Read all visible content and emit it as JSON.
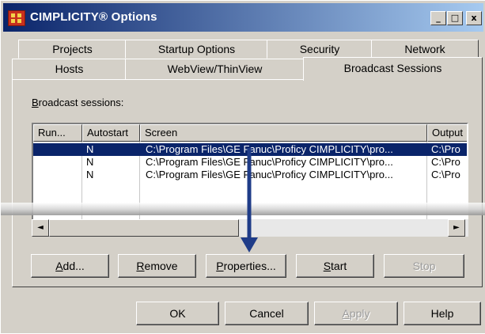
{
  "window": {
    "title": "CIMPLICITY® Options"
  },
  "titlebar_buttons": {
    "minimize": "_",
    "maximize": "□",
    "close": "x"
  },
  "tabs_row1": [
    "Projects",
    "Startup Options",
    "Security",
    "Network"
  ],
  "tabs_row2": [
    "Hosts",
    "WebView/ThinView",
    "Broadcast Sessions"
  ],
  "active_tab": "Broadcast Sessions",
  "section_label": "Broadcast sessions:",
  "list": {
    "columns": [
      "Run...",
      "Autostart",
      "Screen",
      "Output"
    ],
    "rows": [
      {
        "run": "",
        "autostart": "N",
        "screen": "C:\\Program Files\\GE Fanuc\\Proficy CIMPLICITY\\pro...",
        "output": "C:\\Pro",
        "selected": true
      },
      {
        "run": "",
        "autostart": "N",
        "screen": "C:\\Program Files\\GE Fanuc\\Proficy CIMPLICITY\\pro...",
        "output": "C:\\Pro",
        "selected": false
      },
      {
        "run": "",
        "autostart": "N",
        "screen": "C:\\Program Files\\GE Fanuc\\Proficy CIMPLICITY\\pro...",
        "output": "C:\\Pro",
        "selected": false
      }
    ]
  },
  "scroll": {
    "left_arrow": "◄",
    "right_arrow": "►"
  },
  "panel_buttons": {
    "add": "Add...",
    "remove": "Remove",
    "properties": "Properties...",
    "start": "Start",
    "stop": "Stop"
  },
  "dialog_buttons": {
    "ok": "OK",
    "cancel": "Cancel",
    "apply": "Apply",
    "help": "Help"
  },
  "annotation": {
    "arrow_color": "#1f3c88"
  },
  "colors": {
    "title_start": "#0a246a",
    "title_end": "#a6caf0",
    "selection": "#0a246a",
    "face": "#d4d0c8"
  }
}
